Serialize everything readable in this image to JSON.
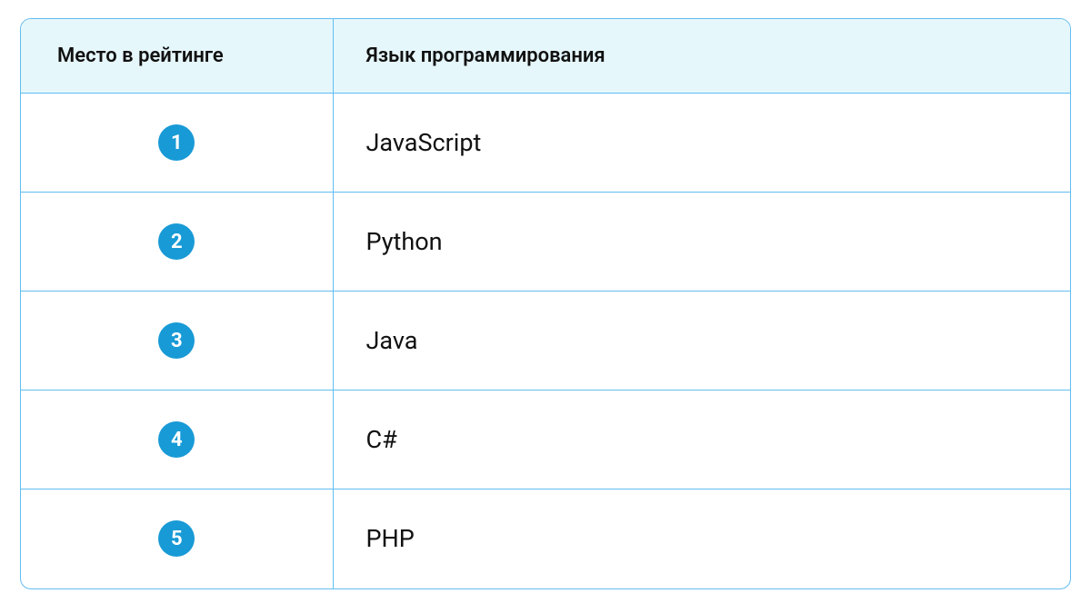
{
  "chart_data": {
    "type": "table",
    "title": "",
    "columns": [
      "Место в рейтинге",
      "Язык программирования"
    ],
    "rows": [
      {
        "rank": 1,
        "language": "JavaScript"
      },
      {
        "rank": 2,
        "language": "Python"
      },
      {
        "rank": 3,
        "language": "Java"
      },
      {
        "rank": 4,
        "language": "C#"
      },
      {
        "rank": 5,
        "language": "PHP"
      }
    ]
  },
  "header": {
    "rank": "Место в рейтинге",
    "language": "Язык программирования"
  },
  "rows": {
    "0": {
      "rank": "1",
      "language": "JavaScript"
    },
    "1": {
      "rank": "2",
      "language": "Python"
    },
    "2": {
      "rank": "3",
      "language": "Java"
    },
    "3": {
      "rank": "4",
      "language": "C#"
    },
    "4": {
      "rank": "5",
      "language": "PHP"
    }
  },
  "colors": {
    "badge_bg": "#189ad6",
    "border": "#62bdf0",
    "header_bg": "#e6f7fb"
  }
}
